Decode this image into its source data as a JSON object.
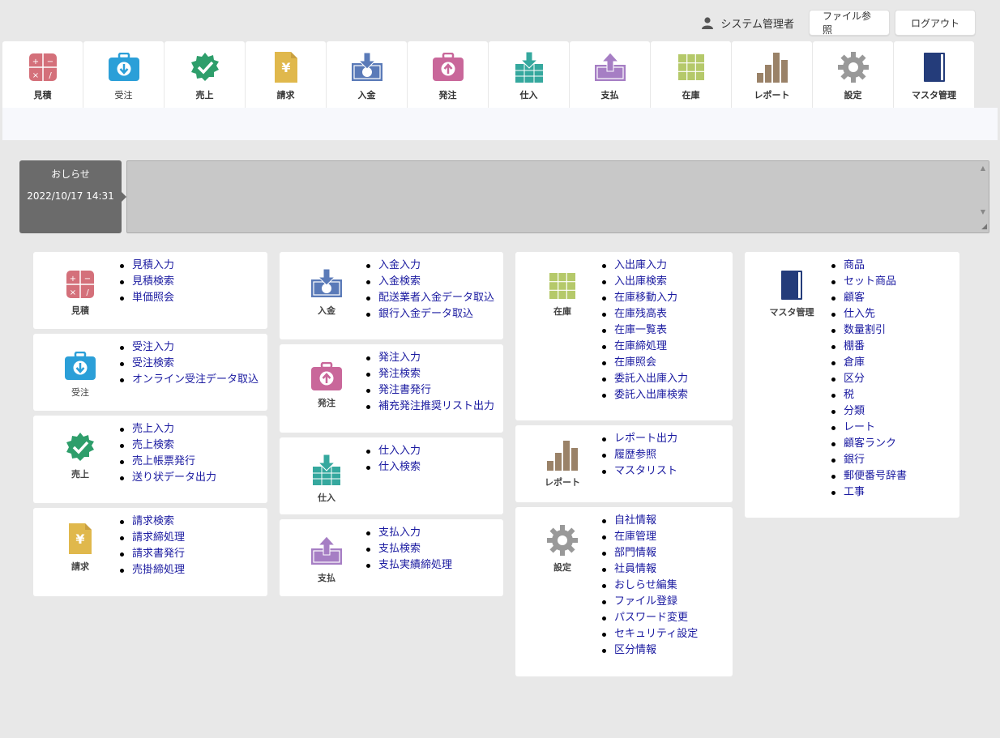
{
  "header": {
    "user_name": "システム管理者",
    "file_button": "ファイル参照",
    "logout_button": "ログアウト"
  },
  "nav": [
    {
      "label": "見積",
      "icon": "calculator-icon",
      "color": "#d4707a"
    },
    {
      "label": "受注",
      "icon": "briefcase-download-icon",
      "color": "#2b9fd8"
    },
    {
      "label": "売上",
      "icon": "checkmark-badge-icon",
      "color": "#2e9e6b"
    },
    {
      "label": "請求",
      "icon": "yen-document-icon",
      "color": "#e0b84c"
    },
    {
      "label": "入金",
      "icon": "deposit-in-icon",
      "color": "#5a7ab8"
    },
    {
      "label": "発注",
      "icon": "briefcase-upload-icon",
      "color": "#c9679a"
    },
    {
      "label": "仕入",
      "icon": "inbox-in-icon",
      "color": "#35a89e"
    },
    {
      "label": "支払",
      "icon": "payment-out-icon",
      "color": "#a67ec4"
    },
    {
      "label": "在庫",
      "icon": "inventory-grid-icon",
      "color": "#b5c96a"
    },
    {
      "label": "レポート",
      "icon": "bar-chart-icon",
      "color": "#9a8268"
    },
    {
      "label": "設定",
      "icon": "gear-icon",
      "color": "#999999"
    },
    {
      "label": "マスタ管理",
      "icon": "master-book-icon",
      "color": "#243c7a"
    }
  ],
  "news": {
    "title": "おしらせ",
    "datetime": "2022/10/17 14:31"
  },
  "cards": {
    "mitsumori": {
      "label": "見積",
      "links": [
        "見積入力",
        "見積検索",
        "単価照会"
      ]
    },
    "juchu": {
      "label": "受注",
      "links": [
        "受注入力",
        "受注検索",
        "オンライン受注データ取込"
      ]
    },
    "uriage": {
      "label": "売上",
      "links": [
        "売上入力",
        "売上検索",
        "売上帳票発行",
        "送り状データ出力"
      ]
    },
    "seikyu": {
      "label": "請求",
      "links": [
        "請求検索",
        "請求締処理",
        "請求書発行",
        "売掛締処理"
      ]
    },
    "nyukin": {
      "label": "入金",
      "links": [
        "入金入力",
        "入金検索",
        "配送業者入金データ取込",
        "銀行入金データ取込"
      ]
    },
    "hatchu": {
      "label": "発注",
      "links": [
        "発注入力",
        "発注検索",
        "発注書発行",
        "補充発注推奨リスト出力"
      ]
    },
    "shiire": {
      "label": "仕入",
      "links": [
        "仕入入力",
        "仕入検索"
      ]
    },
    "shiharai": {
      "label": "支払",
      "links": [
        "支払入力",
        "支払検索",
        "支払実績締処理"
      ]
    },
    "zaiko": {
      "label": "在庫",
      "links": [
        "入出庫入力",
        "入出庫検索",
        "在庫移動入力",
        "在庫残高表",
        "在庫一覧表",
        "在庫締処理",
        "在庫照会",
        "委託入出庫入力",
        "委託入出庫検索"
      ]
    },
    "report": {
      "label": "レポート",
      "links": [
        "レポート出力",
        "履歴参照",
        "マスタリスト"
      ]
    },
    "settei": {
      "label": "設定",
      "links": [
        "自社情報",
        "在庫管理",
        "部門情報",
        "社員情報",
        "おしらせ編集",
        "ファイル登録",
        "パスワード変更",
        "セキュリティ設定",
        "区分情報"
      ]
    },
    "master": {
      "label": "マスタ管理",
      "links": [
        "商品",
        "セット商品",
        "顧客",
        "仕入先",
        "数量割引",
        "棚番",
        "倉庫",
        "区分",
        "税",
        "分類",
        "レート",
        "顧客ランク",
        "銀行",
        "郵便番号辞書",
        "工事"
      ]
    }
  }
}
